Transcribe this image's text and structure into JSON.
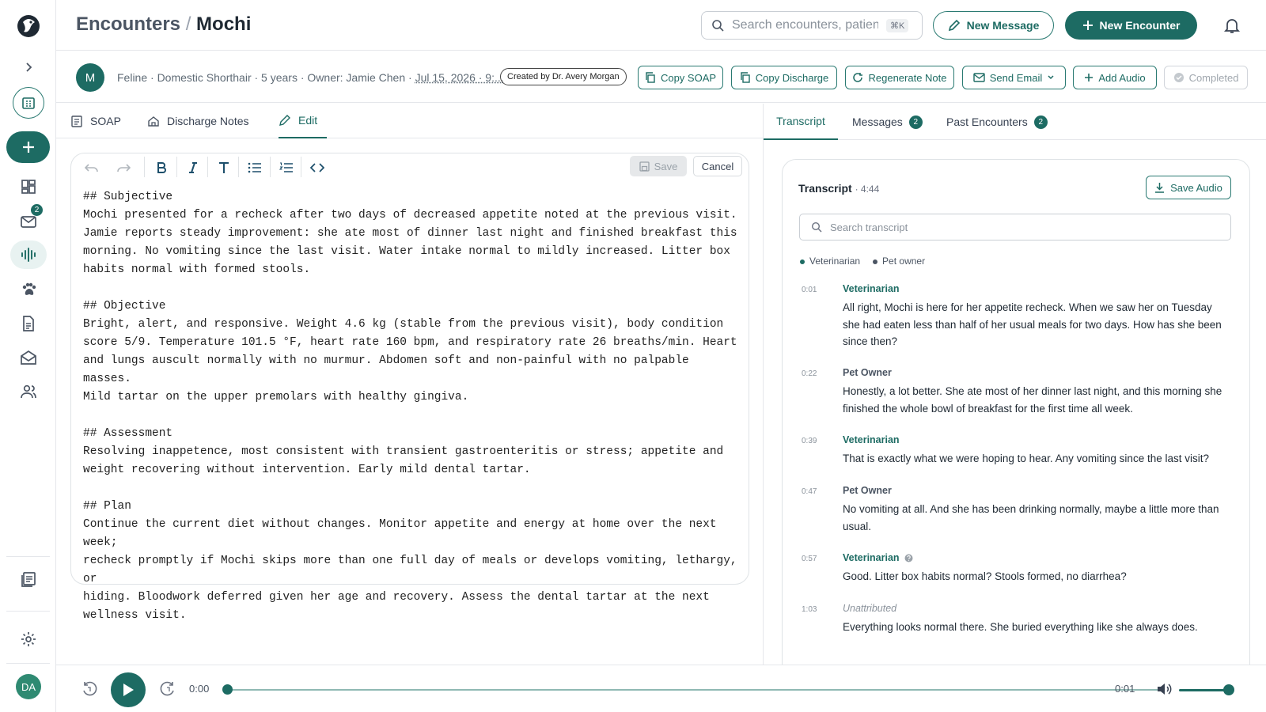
{
  "header": {
    "crumb_parent": "Encounters",
    "crumb_sep": "/",
    "crumb_current": "Mochi",
    "search_placeholder": "Search encounters, patients",
    "search_shortcut": "⌘K",
    "new_message_label": "New Message",
    "new_encounter_label": "New Encounter"
  },
  "sidebar": {
    "messages_badge": "2",
    "user_initials": "DA"
  },
  "patient": {
    "avatar_initial": "M",
    "species_breed": "Feline · Domestic Shorthair · 5 years · Owner: Jamie Chen ·",
    "date": "Jul 15, 2026 · 9:...",
    "created_by": "Created by Dr. Avery Morgan"
  },
  "actions": {
    "copy_soap": "Copy SOAP",
    "copy_discharge": "Copy Discharge",
    "regenerate": "Regenerate Note",
    "send_email": "Send Email",
    "add_audio": "Add Audio",
    "completed": "Completed"
  },
  "left_tabs": {
    "soap": "SOAP",
    "discharge": "Discharge Notes",
    "edit": "Edit"
  },
  "editor": {
    "save_label": "Save",
    "cancel_label": "Cancel",
    "content": "## Subjective\nMochi presented for a recheck after two days of decreased appetite noted at the previous visit.\nJamie reports steady improvement: she ate most of dinner last night and finished breakfast this\nmorning. No vomiting since the last visit. Water intake normal to mildly increased. Litter box\nhabits normal with formed stools.\n\n## Objective\nBright, alert, and responsive. Weight 4.6 kg (stable from the previous visit), body condition\nscore 5/9. Temperature 101.5 °F, heart rate 160 bpm, and respiratory rate 26 breaths/min. Heart\nand lungs auscult normally with no murmur. Abdomen soft and non-painful with no palpable masses.\nMild tartar on the upper premolars with healthy gingiva.\n\n## Assessment\nResolving inappetence, most consistent with transient gastroenteritis or stress; appetite and\nweight recovering without intervention. Early mild dental tartar.\n\n## Plan\nContinue the current diet without changes. Monitor appetite and energy at home over the next week;\nrecheck promptly if Mochi skips more than one full day of meals or develops vomiting, lethargy, or\nhiding. Bloodwork deferred given her age and recovery. Assess the dental tartar at the next\nwellness visit."
  },
  "right_tabs": {
    "transcript": "Transcript",
    "messages": "Messages",
    "messages_count": "2",
    "past": "Past Encounters",
    "past_count": "2"
  },
  "transcript": {
    "title": "Transcript",
    "duration": "· 4:44",
    "save_audio": "Save Audio",
    "search_placeholder": "Search transcript",
    "legend_vet": "Veterinarian",
    "legend_owner": "Pet owner",
    "colors": {
      "vet": "#1d6b63",
      "owner": "#4b5563"
    },
    "entries": [
      {
        "time": "0:01",
        "speaker": "Veterinarian",
        "text": "All right, Mochi is here for her appetite recheck. When we saw her on Tuesday she had eaten less than half of her usual meals for two days. How has she been since then?"
      },
      {
        "time": "0:22",
        "speaker": "Pet Owner",
        "text": "Honestly, a lot better. She ate most of her dinner last night, and this morning she finished the whole bowl of breakfast for the first time all week."
      },
      {
        "time": "0:39",
        "speaker": "Veterinarian",
        "text": "That is exactly what we were hoping to hear. Any vomiting since the last visit?"
      },
      {
        "time": "0:47",
        "speaker": "Pet Owner",
        "text": "No vomiting at all. And she has been drinking normally, maybe a little more than usual."
      },
      {
        "time": "0:57",
        "speaker": "Veterinarian",
        "text": "Good. Litter box habits normal? Stools formed, no diarrhea?"
      },
      {
        "time": "1:03",
        "speaker": "Unattributed",
        "text": "Everything looks normal there. She buried everything like she always does."
      }
    ]
  },
  "player": {
    "current_time": "0:00",
    "end_time": "0:01",
    "progress": 0,
    "volume": 0.95
  },
  "theme": {
    "accent": "#1d6b63"
  }
}
